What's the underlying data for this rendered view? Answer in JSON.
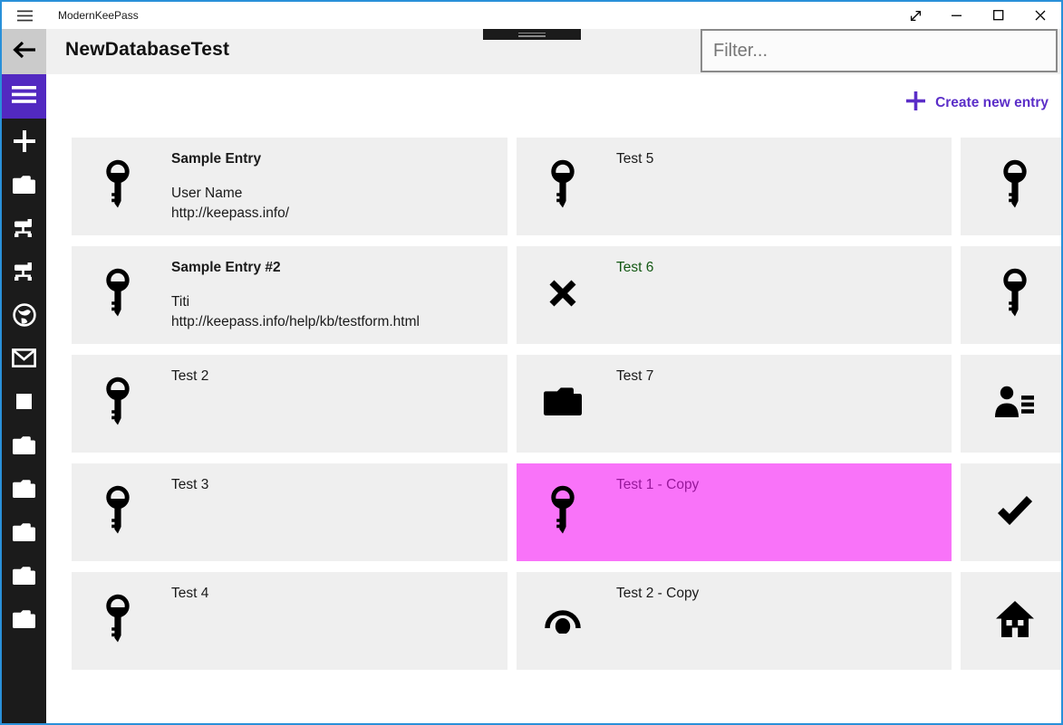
{
  "window": {
    "title": "ModernKeePass",
    "controls": [
      {
        "name": "resize-diagonal",
        "label": "Resize"
      },
      {
        "name": "minimize",
        "label": "Minimize"
      },
      {
        "name": "maximize",
        "label": "Maximize"
      },
      {
        "name": "close",
        "label": "Close"
      }
    ]
  },
  "header": {
    "page_title": "NewDatabaseTest",
    "filter_placeholder": "Filter...",
    "filter_value": ""
  },
  "toolbar": {
    "create_label": "Create new entry"
  },
  "colors": {
    "accent_purple": "#5b2ec8",
    "sidebar_purple": "#5229c1",
    "selected_bg": "#f973f9",
    "selected_title": "#97189b",
    "green_title": "#135813",
    "card_bg": "#efefef",
    "window_border_blue": "#2990d9"
  },
  "sidebar": {
    "items": [
      {
        "icon": "hamburger"
      },
      {
        "icon": "plus"
      },
      {
        "icon": "folder"
      },
      {
        "icon": "device"
      },
      {
        "icon": "device"
      },
      {
        "icon": "globe"
      },
      {
        "icon": "mail"
      },
      {
        "icon": "square"
      },
      {
        "icon": "folder"
      },
      {
        "icon": "folder"
      },
      {
        "icon": "folder"
      },
      {
        "icon": "folder"
      },
      {
        "icon": "folder"
      }
    ]
  },
  "grid": {
    "rows": [
      {
        "cells": [
          {
            "icon": "key",
            "title": "Sample Entry",
            "title_bold": true,
            "lines": [
              "User Name",
              "http://keepass.info/"
            ]
          },
          {
            "icon": "key",
            "title": "Test 5"
          },
          {
            "icon": "key"
          }
        ]
      },
      {
        "cells": [
          {
            "icon": "key",
            "title": "Sample Entry #2",
            "title_bold": true,
            "lines": [
              "Titi",
              "http://keepass.info/help/kb/testform.html"
            ]
          },
          {
            "icon": "cross",
            "title": "Test 6",
            "title_color": "#135813"
          },
          {
            "icon": "key"
          }
        ]
      },
      {
        "cells": [
          {
            "icon": "key",
            "title": "Test 2"
          },
          {
            "icon": "folder-dark",
            "title": "Test 7"
          },
          {
            "icon": "contact-list"
          }
        ]
      },
      {
        "cells": [
          {
            "icon": "key",
            "title": "Test 3"
          },
          {
            "icon": "key",
            "title": "Test 1 - Copy",
            "selected": true,
            "title_color": "#97189b"
          },
          {
            "icon": "check"
          }
        ]
      },
      {
        "cells": [
          {
            "icon": "key",
            "title": "Test 4"
          },
          {
            "icon": "arc-dot",
            "title": "Test 2 - Copy"
          },
          {
            "icon": "home"
          }
        ]
      }
    ]
  }
}
